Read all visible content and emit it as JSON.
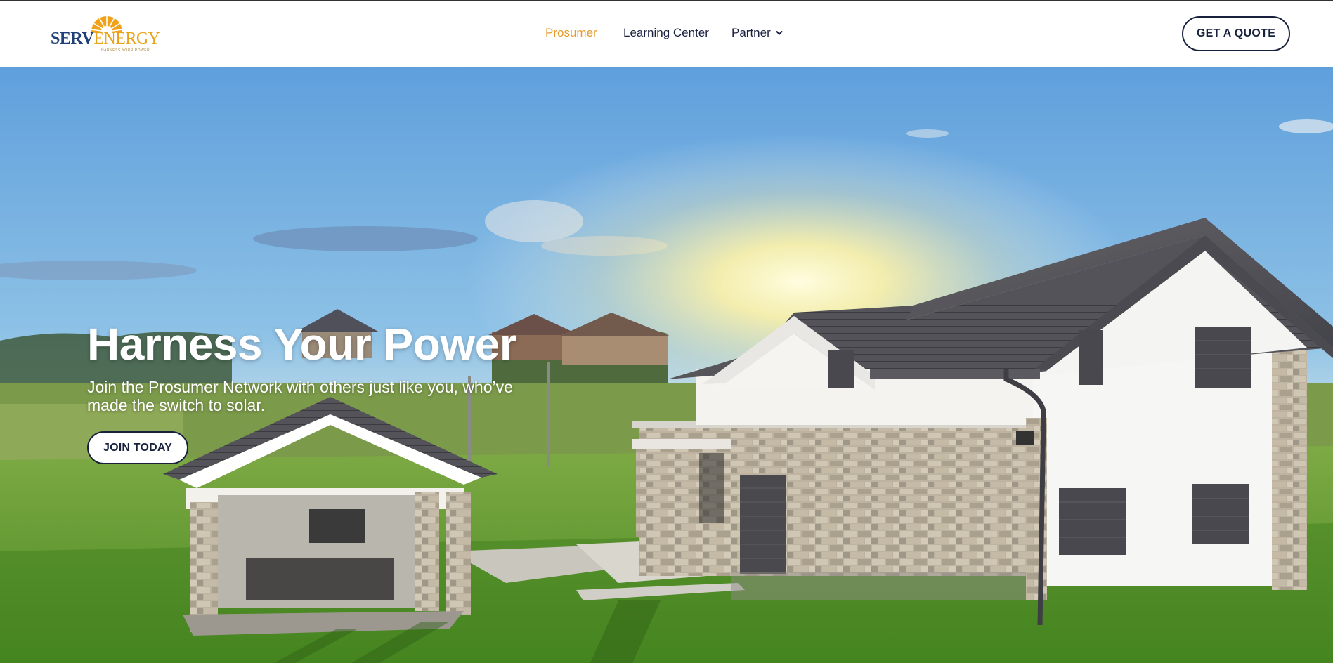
{
  "brand": {
    "name_part1": "SERV",
    "name_part2": "ENERGY",
    "tagline": "HARNESS YOUR POWER",
    "colors": {
      "navy": "#1f3f78",
      "gold": "#e9a31a"
    }
  },
  "nav": {
    "items": [
      {
        "label": "Prosumer",
        "active": true
      },
      {
        "label": "Learning Center",
        "active": false
      },
      {
        "label": "Partner",
        "active": false,
        "has_dropdown": true
      }
    ],
    "cta_label": "GET A QUOTE"
  },
  "hero": {
    "title": "Harness Your Power",
    "subtitle": "Join the Prosumer Network with others just like you, who’ve made the switch to solar.",
    "cta_label": "JOIN TODAY",
    "background_icon": "house-with-solar-roof-image"
  },
  "colors": {
    "accent": "#e89b2c",
    "text_dark": "#17213d"
  }
}
